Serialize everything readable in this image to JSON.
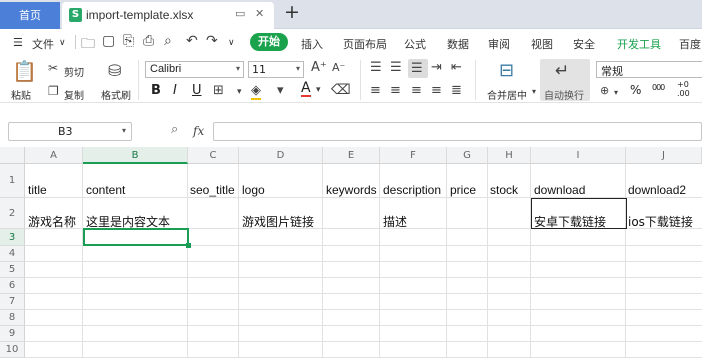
{
  "tabbar": {
    "home": "首页",
    "file": "import-template.xlsx",
    "plus": "+"
  },
  "menu": {
    "file": "文件",
    "items": [
      "开始",
      "插入",
      "页面布局",
      "公式",
      "数据",
      "审阅",
      "视图",
      "安全",
      "开发工具",
      "百度"
    ]
  },
  "ribbon": {
    "paste": "粘贴",
    "cut": "剪切",
    "copy": "复制",
    "format_painter": "格式刷",
    "font": "Calibri",
    "size": "11",
    "bold": "B",
    "italic": "I",
    "underline": "U",
    "merge": "合并居中",
    "wrap": "自动换行",
    "number_format": "常规",
    "percent": "%",
    "thousands": "000",
    "dec_inc": "+0 .00",
    "dec_dec": ".00 +0"
  },
  "formula": {
    "cell_ref": "B3",
    "fx": "fx",
    "value": ""
  },
  "grid": {
    "columns": [
      "A",
      "B",
      "C",
      "D",
      "E",
      "F",
      "G",
      "H",
      "I",
      "J"
    ],
    "rows": [
      "1",
      "2",
      "3",
      "4",
      "5",
      "6",
      "7",
      "8",
      "9",
      "10"
    ],
    "row1": [
      "title",
      "content",
      "seo_title",
      "logo",
      "keywords",
      "description",
      "price",
      "stock",
      "download",
      "download2"
    ],
    "row2": {
      "A": "游戏名称",
      "B": "这里是内容文本",
      "D": "游戏图片链接",
      "F": "描述",
      "I": "安卓下载链接",
      "J": "ios下载链接"
    },
    "selected_cell": "B3"
  },
  "colors": {
    "accent": "#1aa24d",
    "home_tab": "#4c7fd8",
    "dev_tools": "#1aa24d"
  },
  "icons": [
    "menu-icon",
    "folder-icon",
    "save-icon",
    "print-icon",
    "undo-icon",
    "redo-icon",
    "dropdown-icon",
    "close-icon",
    "zoom-icon"
  ]
}
